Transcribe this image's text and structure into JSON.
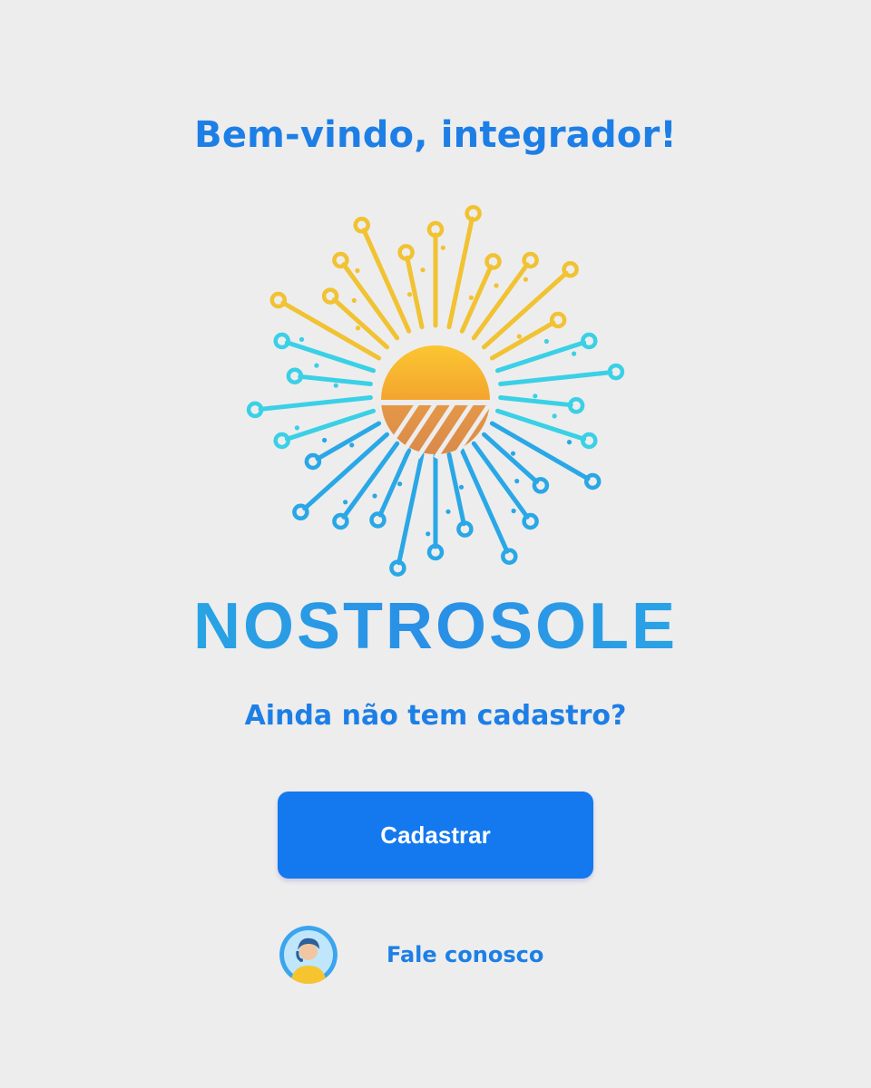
{
  "header": {
    "welcome": "Bem-vindo, integrador!"
  },
  "logo": {
    "icon": "sun-circuit-logo",
    "brand_name": "NOSTROSOLE",
    "colors": {
      "sun_top": "#f6b126",
      "sun_bottom": "#f4a93a",
      "rays_warm": "#f1c232",
      "rays_cool": "#2aa7e6",
      "rays_teal": "#3ad0e6"
    }
  },
  "signup": {
    "question": "Ainda não tem cadastro?",
    "button_label": "Cadastrar"
  },
  "contact": {
    "avatar_icon": "support-agent-avatar",
    "label": "Fale conosco"
  },
  "theme": {
    "background": "#ededed",
    "primary": "#1479ee",
    "text_accent": "#1d7fe6"
  }
}
